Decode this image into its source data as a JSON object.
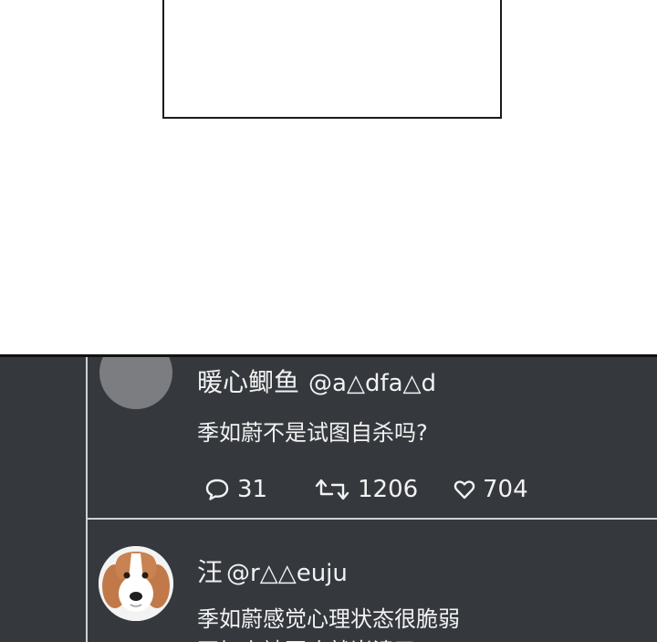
{
  "posts": [
    {
      "name": "暖心鲫鱼",
      "handle": "@a△dfa△d",
      "text": "季如蔚不是试图自杀吗?",
      "stats": {
        "comments": "31",
        "reposts": "1206",
        "likes": "704"
      }
    },
    {
      "name": "汪",
      "handle": "@r△△euju",
      "text_lines": [
        "季如蔚感觉心理状态很脆弱",
        "再加上被圈攻就崩溃了"
      ]
    }
  ],
  "colors": {
    "feed_bg": "#35383d",
    "text": "#f2f2f2",
    "rule": "#cfd0d2"
  },
  "icons": [
    "comment-icon",
    "repost-icon",
    "heart-icon",
    "dog-avatar-icon"
  ]
}
